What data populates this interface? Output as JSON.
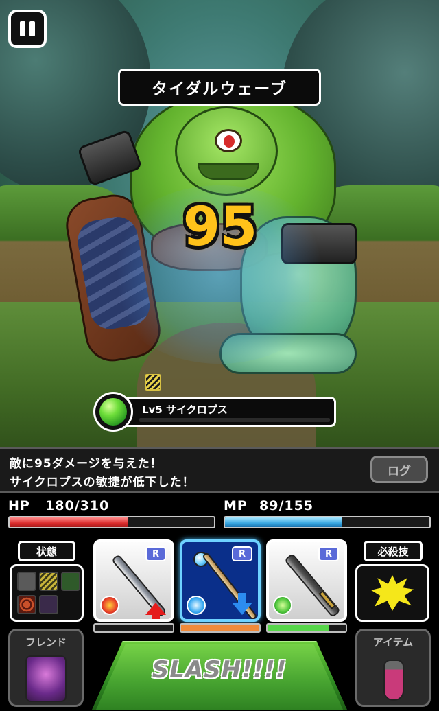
{
  "hud": {
    "skill_name": "タイダルウェーブ",
    "damage": "95"
  },
  "enemy": {
    "name": "Lv5 サイクロプス",
    "element_icon": "wood-orb-icon",
    "element_color": "#5acd34",
    "status_icon": "agility-down-icon"
  },
  "message": {
    "line1": "敵に95ダメージを与えた！",
    "line2": "サイクロプスの敏捷が低下した！",
    "log_button": "ログ"
  },
  "player": {
    "hp_label": "HP",
    "hp_value": "180/310",
    "hp_current": 180,
    "hp_max": 310,
    "mp_label": "MP",
    "mp_value": "89/155",
    "mp_current": 89,
    "mp_max": 155
  },
  "status": {
    "label": "状態",
    "icons": [
      "eye-icon",
      "zigzag-icon",
      "sleep-icon",
      "spiral-icon",
      "dice-icon"
    ]
  },
  "weapons": [
    {
      "badge": "R",
      "icon": "sword-icon",
      "element": "fire-icon",
      "element_color": "#e8402a",
      "trend": "up",
      "gauge": 0.0,
      "gauge_color": "#ffffff",
      "selected": false
    },
    {
      "badge": "R",
      "icon": "staff-icon",
      "element": "water-icon",
      "element_color": "#39a9f2",
      "trend": "down",
      "gauge": 1.0,
      "gauge_color": "#f08a3a",
      "selected": true
    },
    {
      "badge": "R",
      "icon": "greatsword-icon",
      "element": "wood-icon",
      "element_color": "#4cc43a",
      "trend": "none",
      "gauge": 0.78,
      "gauge_color": "#57d64a",
      "selected": false
    }
  ],
  "special": {
    "label": "必殺技",
    "icon": "special-burst-icon"
  },
  "buttons": {
    "friend": "フレンド",
    "item": "アイテム",
    "slash": "SLASH!!!!"
  }
}
